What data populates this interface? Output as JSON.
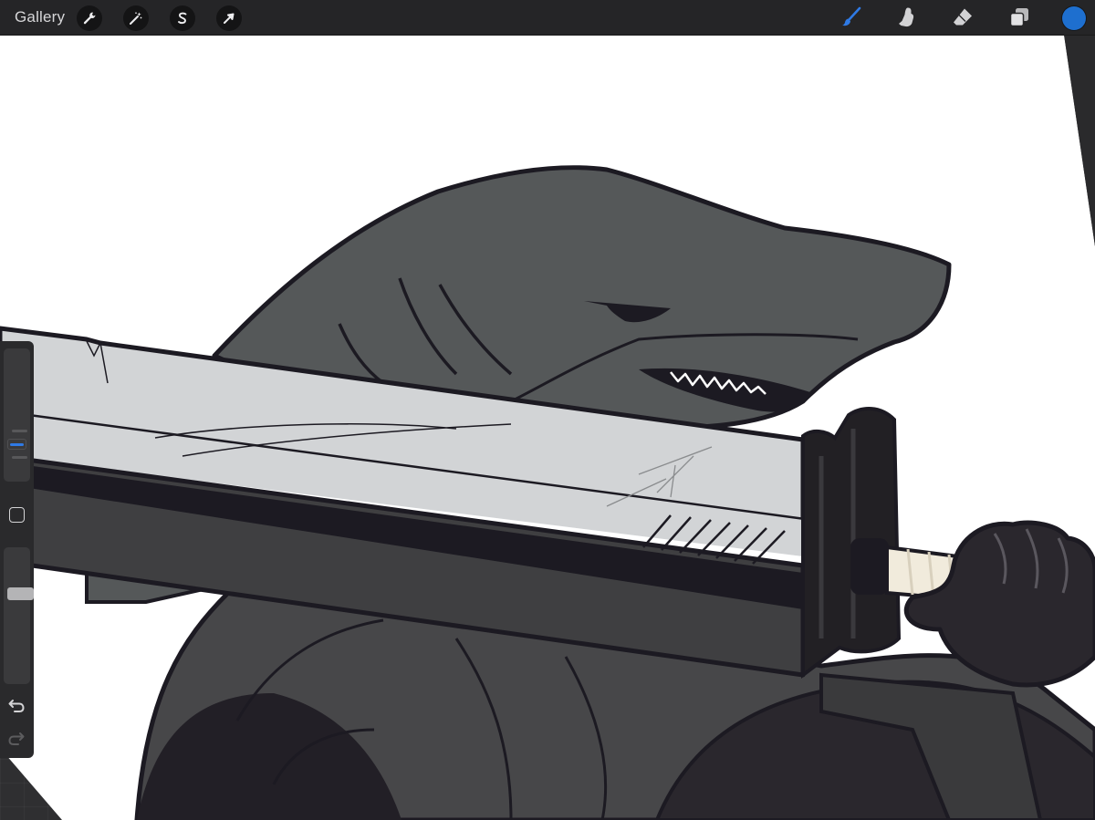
{
  "topbar": {
    "gallery_label": "Gallery",
    "left_tools": [
      {
        "name": "actions",
        "icon": "wrench-icon"
      },
      {
        "name": "adjustments",
        "icon": "magic-wand-icon"
      },
      {
        "name": "selection",
        "icon": "selection-s-icon"
      },
      {
        "name": "transform",
        "icon": "arrow-cursor-icon"
      }
    ],
    "right_tools": [
      {
        "name": "brush",
        "icon": "brush-icon",
        "active": true
      },
      {
        "name": "smudge",
        "icon": "smudge-finger-icon",
        "active": false
      },
      {
        "name": "eraser",
        "icon": "eraser-icon",
        "active": false
      },
      {
        "name": "layers",
        "icon": "layers-icon",
        "active": false
      }
    ],
    "current_color": "#1e6fcf"
  },
  "sidebar": {
    "brush_size_slider": {
      "icon": "size-slider"
    },
    "modify_button": {
      "icon": "square-modify-icon"
    },
    "brush_opacity_slider": {
      "icon": "opacity-slider"
    },
    "undo": {
      "icon": "undo-arrow-icon",
      "enabled": true
    },
    "redo": {
      "icon": "redo-arrow-icon",
      "enabled": false
    }
  },
  "colors": {
    "accent": "#2f7ae5",
    "shark_gray": "#555859",
    "outline": "#1c1a22",
    "blade": "#d2d4d6",
    "hilt": "#222024",
    "grip": "#f1ebdc",
    "cloak": "#474749"
  }
}
